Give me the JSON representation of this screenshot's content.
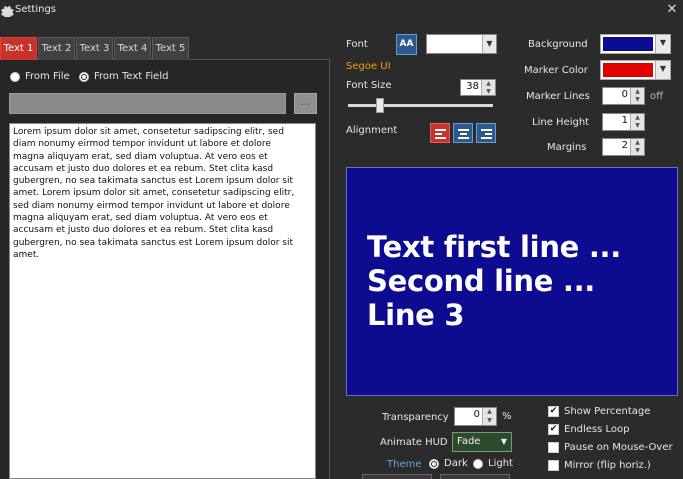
{
  "window": {
    "title": "Settings",
    "close_icon": "close-icon",
    "settings_icon": "gear-icon"
  },
  "tabs": [
    {
      "label": "Text 1",
      "active": true
    },
    {
      "label": "Text 2",
      "active": false
    },
    {
      "label": "Text 3",
      "active": false
    },
    {
      "label": "Text 4",
      "active": false
    },
    {
      "label": "Text 5",
      "active": false
    }
  ],
  "source": {
    "from_file_label": "From File",
    "from_text_field_label": "From Text Field",
    "selected": "From Text Field",
    "file_path": "",
    "browse_button_label": "..."
  },
  "text_content": "Lorem ipsum dolor sit amet, consetetur sadipscing elitr, sed\ndiam nonumy eirmod tempor invidunt ut labore et dolore\nmagna aliquyam erat, sed diam voluptua. At vero eos et\naccusam et justo duo dolores et ea rebum. Stet clita kasd\ngubergren, no sea takimata sanctus est Lorem ipsum dolor sit\namet. Lorem ipsum dolor sit amet, consetetur sadipscing elitr,\nsed diam nonumy eirmod tempor invidunt ut labore et dolore\nmagna aliquyam erat, sed diam voluptua. At vero eos et\naccusam et justo duo dolores et ea rebum. Stet clita kasd\ngubergren, no sea takimata sanctus est Lorem ipsum dolor sit\namet.",
  "font": {
    "label": "Font",
    "font_button_label": "AA",
    "font_name": "Segoe UI",
    "font_name_color": "#f0a400",
    "size_label": "Font Size",
    "size_value": "38",
    "size_slider_fraction": 0.22,
    "alignment_label": "Alignment",
    "alignment_selected": "left",
    "alignment_options": [
      "left",
      "center",
      "right"
    ]
  },
  "colors": {
    "background_label": "Background",
    "background_value": "#0d0b8f",
    "marker_color_label": "Marker Color",
    "marker_color_value": "#e00000",
    "marker_lines_label": "Marker Lines",
    "marker_lines_value": "0",
    "marker_lines_suffix": "off",
    "line_height_label": "Line Height",
    "line_height_value": "1",
    "margins_label": "Margins",
    "margins_value": "2"
  },
  "preview": {
    "lines": [
      "Text first line ...",
      "Second line ...",
      "Line 3"
    ],
    "text_color": "#ffffff"
  },
  "bottom": {
    "transparency_label": "Transparency",
    "transparency_value": "0",
    "transparency_unit": "%",
    "animate_label": "Animate HUD",
    "animate_value": "Fade",
    "theme_label": "Theme",
    "theme_dark": "Dark",
    "theme_light": "Light",
    "theme_selected": "Dark",
    "show_percentage_label": "Show Percentage",
    "show_percentage": true,
    "endless_loop_label": "Endless Loop",
    "endless_loop": true,
    "pause_label": "Pause on Mouse-Over",
    "pause": false,
    "mirror_label": "Mirror (flip horiz.)",
    "mirror": false
  }
}
